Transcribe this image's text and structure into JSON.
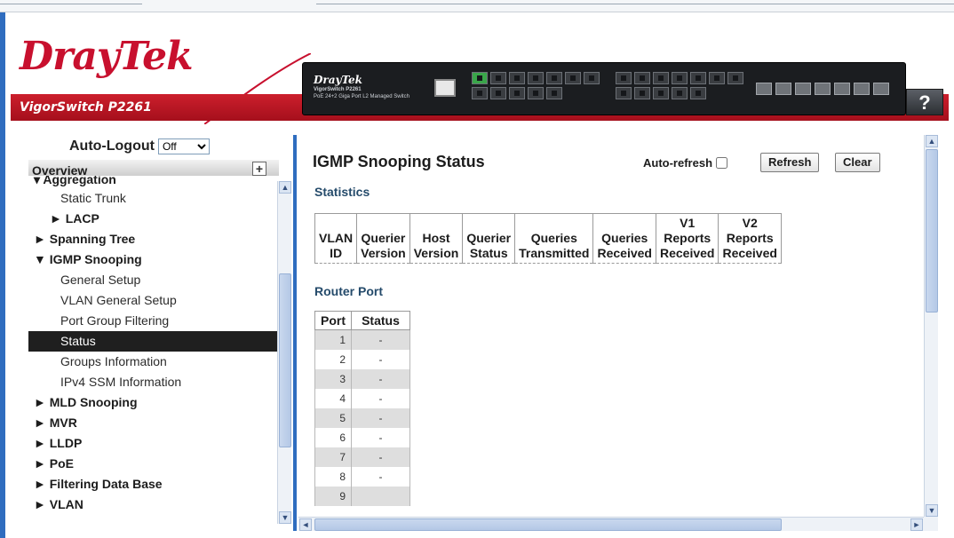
{
  "header": {
    "brand": "DrayTek",
    "model": "VigorSwitch P2261",
    "device_brand": "DrayTek",
    "device_model": "VigorSwitch P2261",
    "device_desc": "PoE 24+2 Giga Port L2 Managed Switch",
    "help_label": "?"
  },
  "sidebar": {
    "autologout_label": "Auto-Logout",
    "autologout_value": "Off",
    "overview_label": "Overview",
    "menu": [
      {
        "label": "▾ Aggregation",
        "style": "bold cut"
      },
      {
        "label": "Static Trunk",
        "style": "sub"
      },
      {
        "label": "► LACP",
        "style": "sub2"
      },
      {
        "label": "► Spanning Tree",
        "style": "bold"
      },
      {
        "label": "▼ IGMP Snooping",
        "style": "bold"
      },
      {
        "label": "General Setup",
        "style": "sub"
      },
      {
        "label": "VLAN General Setup",
        "style": "sub"
      },
      {
        "label": "Port Group Filtering",
        "style": "sub"
      },
      {
        "label": "Status",
        "style": "sub active"
      },
      {
        "label": "Groups Information",
        "style": "sub"
      },
      {
        "label": "IPv4 SSM Information",
        "style": "sub"
      },
      {
        "label": "► MLD Snooping",
        "style": "bold"
      },
      {
        "label": "► MVR",
        "style": "bold"
      },
      {
        "label": "► LLDP",
        "style": "bold"
      },
      {
        "label": "► PoE",
        "style": "bold"
      },
      {
        "label": "► Filtering Data Base",
        "style": "bold"
      },
      {
        "label": "► VLAN",
        "style": "bold"
      }
    ]
  },
  "main": {
    "title": "IGMP Snooping Status",
    "auto_refresh_label": "Auto-refresh",
    "refresh_label": "Refresh",
    "clear_label": "Clear",
    "statistics_title": "Statistics",
    "statistics_columns": [
      [
        "VLAN",
        "ID"
      ],
      [
        "Querier",
        "Version"
      ],
      [
        "Host",
        "Version"
      ],
      [
        "Querier",
        "Status"
      ],
      [
        "Queries",
        "Transmitted"
      ],
      [
        "Queries",
        "Received"
      ],
      [
        "V1",
        "Reports",
        "Received"
      ],
      [
        "V2",
        "Reports",
        "Received"
      ]
    ],
    "router_port_title": "Router Port",
    "router_port_columns": [
      "Port",
      "Status"
    ],
    "router_ports": [
      {
        "port": "1",
        "status": "-"
      },
      {
        "port": "2",
        "status": "-"
      },
      {
        "port": "3",
        "status": "-"
      },
      {
        "port": "4",
        "status": "-"
      },
      {
        "port": "5",
        "status": "-"
      },
      {
        "port": "6",
        "status": "-"
      },
      {
        "port": "7",
        "status": "-"
      },
      {
        "port": "8",
        "status": "-"
      },
      {
        "port": "9",
        "status": ""
      }
    ]
  },
  "colors": {
    "brand_red": "#c8102e",
    "frame_blue": "#2f6dbf",
    "active_item": "#1f1f1f",
    "section_title": "#254b6b"
  },
  "icons": {
    "overview_toggle": "plus-icon",
    "scroll_up": "arrow-up-icon",
    "scroll_down": "arrow-down-icon",
    "scroll_left": "arrow-left-icon",
    "scroll_right": "arrow-right-icon"
  }
}
